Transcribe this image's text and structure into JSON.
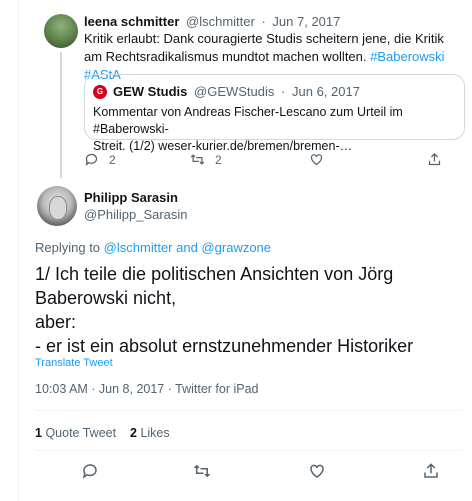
{
  "parent_tweet": {
    "name": "leena schmitter",
    "handle": "@lschmitter",
    "separator": "·",
    "date": "Jun 7, 2017",
    "text_plain": "Kritik erlaubt: Dank couragierte Studis scheitern jene, die Kritik am Rechtsradikalismus mundtot machen wollten.",
    "hashtag_1": "#Baberowski",
    "hashtag_2": "#AStA",
    "quote": {
      "name": "GEW Studis",
      "handle": "@GEWStudis",
      "date": "Jun 6, 2017",
      "text_plain": "Kommentar von Andreas Fischer-Lescano zum Urteil im",
      "hashtag": "#Baberowski-",
      "text_rest": "Streit. (1/2) weser-kurier.de/bremen/bremen-…"
    },
    "actions": {
      "reply_count": "2",
      "retweet_count": "2"
    }
  },
  "main_tweet": {
    "name": "Philipp Sarasin",
    "handle": "@Philipp_Sarasin",
    "replying_prefix": "Replying to",
    "replying_user_1": "@lschmitter",
    "replying_and": "and",
    "replying_user_2": "@grawzone",
    "text_lines": [
      "1/ Ich teile die politischen Ansichten von Jörg",
      "Baberowski nicht,",
      "aber:",
      "- er ist ein absolut ernstzunehmender Historiker"
    ],
    "translate_label": "Translate Tweet",
    "timestamp": "10:03 AM · Jun 8, 2017 · Twitter for iPad",
    "quote_tweet_count": "1",
    "quote_tweet_label": "Quote Tweet",
    "likes_count": "2",
    "likes_label": "Likes"
  },
  "colors": {
    "link": "#1d9bf0",
    "secondary_text": "#536471",
    "primary_text": "#0f1419",
    "gew_logo": "#d7001f"
  },
  "icons": {
    "reply": "reply-icon",
    "retweet": "retweet-icon",
    "like": "like-icon",
    "share": "share-icon"
  }
}
